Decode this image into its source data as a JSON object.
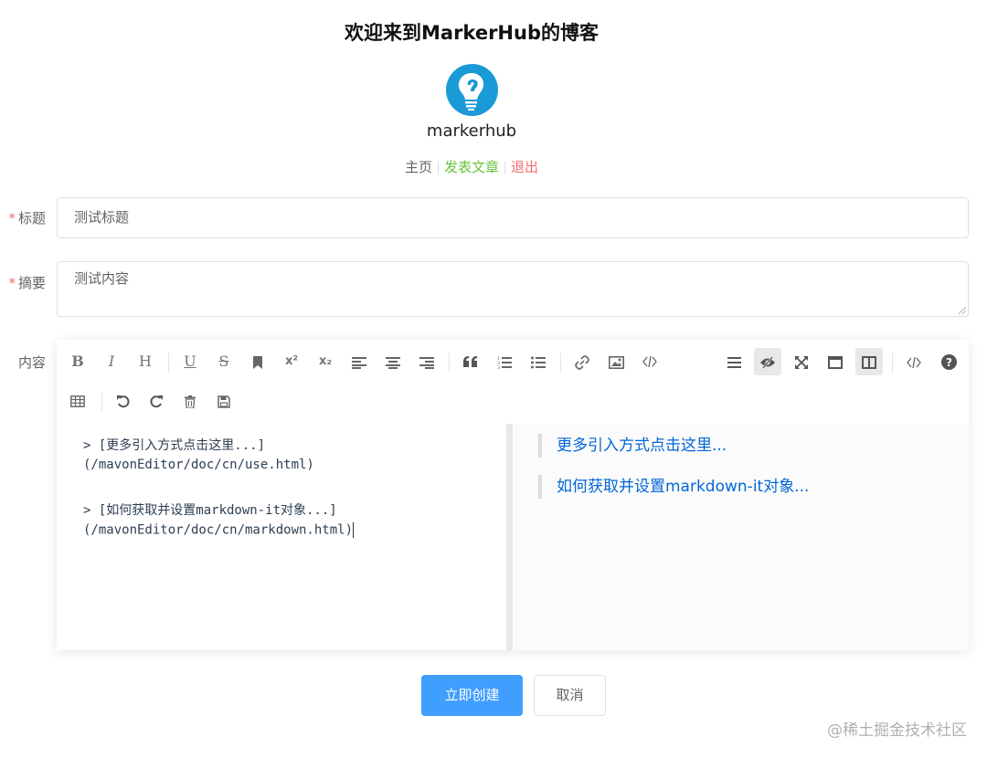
{
  "header": {
    "site_title": "欢迎来到MarkerHub的博客",
    "username": "markerhub",
    "nav": {
      "home": "主页",
      "post": "发表文章",
      "logout": "退出"
    }
  },
  "form": {
    "title_label": "标题",
    "title_value": "测试标题",
    "summary_label": "摘要",
    "summary_placeholder": "测试内容",
    "content_label": "内容",
    "required_mark": "*"
  },
  "editor": {
    "toolbar": {
      "bold": "B",
      "italic": "I",
      "header": "H",
      "underline": "U",
      "strike": "S",
      "superscript": "x²",
      "subscript": "x₂"
    },
    "source_lines": [
      "> [更多引入方式点击这里...]",
      "(/mavonEditor/doc/cn/use.html)",
      "> [如何获取并设置markdown-it对象...]",
      "(/mavonEditor/doc/cn/markdown.html)"
    ],
    "preview_links": [
      "更多引入方式点击这里...",
      "如何获取并设置markdown-it对象..."
    ]
  },
  "actions": {
    "create": "立即创建",
    "cancel": "取消"
  },
  "watermark": "@稀土掘金技术社区",
  "colors": {
    "primary": "#409eff",
    "success": "#67c23a",
    "danger": "#f56c6c",
    "link": "#0366d6"
  }
}
